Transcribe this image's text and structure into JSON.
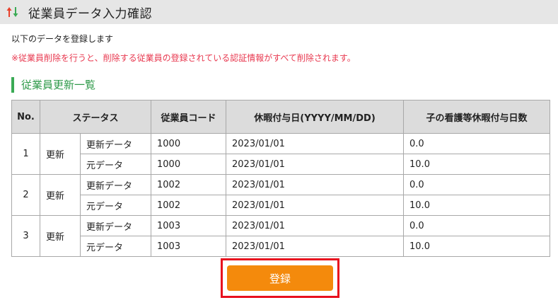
{
  "header": {
    "title": "従業員データ入力確認",
    "icon": "up-down-arrows-icon"
  },
  "intro_text": "以下のデータを登録します",
  "warning_text": "※従業員削除を行うと、削除する従業員の登録されている認証情報がすべて削除されます。",
  "section_title": "従業員更新一覧",
  "table": {
    "headers": {
      "no": "No.",
      "status": "ステータス",
      "code": "従業員コード",
      "leave_date": "休暇付与日(YYYY/MM/DD)",
      "child_care_days": "子の看護等休暇付与日数"
    },
    "groups": [
      {
        "no": "1",
        "status": "更新",
        "rows": [
          {
            "type": "更新データ",
            "code": "1000",
            "date": "2023/01/01",
            "days": "0.0"
          },
          {
            "type": "元データ",
            "code": "1000",
            "date": "2023/01/01",
            "days": "10.0"
          }
        ]
      },
      {
        "no": "2",
        "status": "更新",
        "rows": [
          {
            "type": "更新データ",
            "code": "1002",
            "date": "2023/01/01",
            "days": "0.0"
          },
          {
            "type": "元データ",
            "code": "1002",
            "date": "2023/01/01",
            "days": "10.0"
          }
        ]
      },
      {
        "no": "3",
        "status": "更新",
        "rows": [
          {
            "type": "更新データ",
            "code": "1003",
            "date": "2023/01/01",
            "days": "0.0"
          },
          {
            "type": "元データ",
            "code": "1003",
            "date": "2023/01/01",
            "days": "10.0"
          }
        ]
      }
    ]
  },
  "register_button": {
    "label": "登録"
  },
  "colors": {
    "accent_green": "#3aaa55",
    "warning_red": "#e8384f",
    "button_orange": "#f48a0c",
    "highlight_red": "#e8101e"
  }
}
